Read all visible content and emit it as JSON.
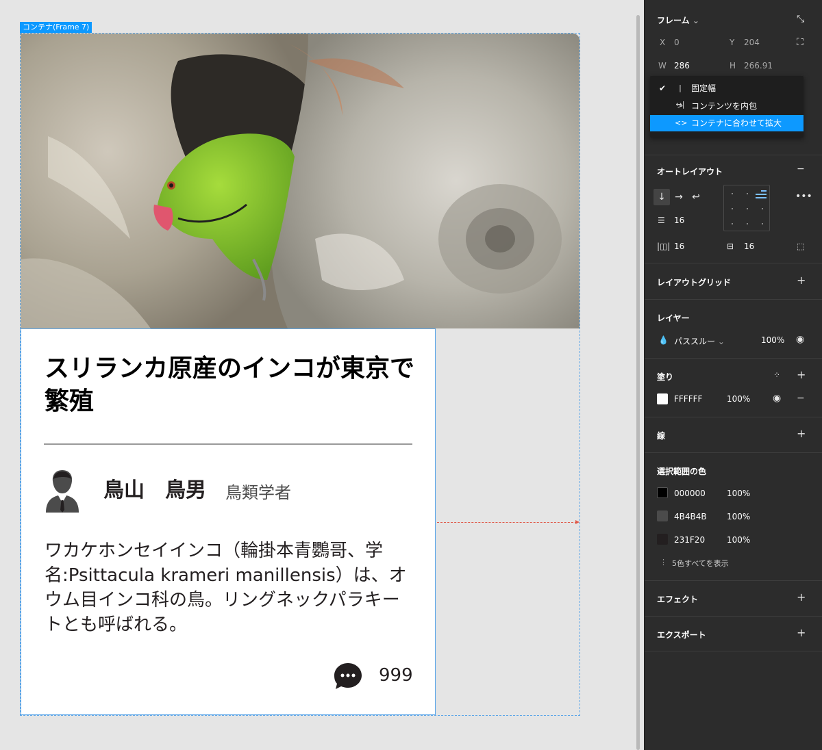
{
  "canvas": {
    "frame_label": "コンテナ(Frame 7)",
    "card": {
      "title": "スリランカ原産のインコが東京で繁殖",
      "author_name": "鳥山　鳥男",
      "author_role": "鳥類学者",
      "body": "ワカケホンセイインコ（輪掛本青鸚哥、学名:Psittacula krameri manillensis）は、オウム目インコ科の鳥。リングネックパラキートとも呼ばれる。",
      "comment_count": "999",
      "icons": {
        "avatar": "businessman-avatar-icon",
        "comment": "chat-bubble-icon"
      }
    }
  },
  "panel": {
    "frame": {
      "title": "フレーム",
      "x_label": "X",
      "x_value": "0",
      "y_label": "Y",
      "y_value": "204",
      "w_label": "W",
      "w_value": "286",
      "h_label": "H",
      "h_value": "266.91"
    },
    "resize_menu": {
      "items": [
        {
          "label": "固定幅",
          "checked": true,
          "selected": false
        },
        {
          "label": "コンテンツを内包",
          "checked": false,
          "selected": false
        },
        {
          "label": "コンテナに合わせて拡大",
          "checked": false,
          "selected": true
        }
      ]
    },
    "auto_layout": {
      "title": "オートレイアウト",
      "spacing": "16",
      "padding_horizontal": "16",
      "padding_vertical": "16",
      "direction": "vertical"
    },
    "layout_grid": {
      "title": "レイアウトグリッド"
    },
    "layer": {
      "title": "レイヤー",
      "blend_mode": "パススルー",
      "opacity": "100%"
    },
    "fill": {
      "title": "塗り",
      "color": "FFFFFF",
      "opacity": "100%"
    },
    "stroke": {
      "title": "線"
    },
    "selection_colors": {
      "title": "選択範囲の色",
      "colors": [
        {
          "hex": "000000",
          "opacity": "100%",
          "swatch": "#000000"
        },
        {
          "hex": "4B4B4B",
          "opacity": "100%",
          "swatch": "#4b4b4b"
        },
        {
          "hex": "231F20",
          "opacity": "100%",
          "swatch": "#231f20"
        }
      ],
      "show_all": "5色すべてを表示"
    },
    "effects": {
      "title": "エフェクト"
    },
    "export": {
      "title": "エクスポート"
    }
  }
}
